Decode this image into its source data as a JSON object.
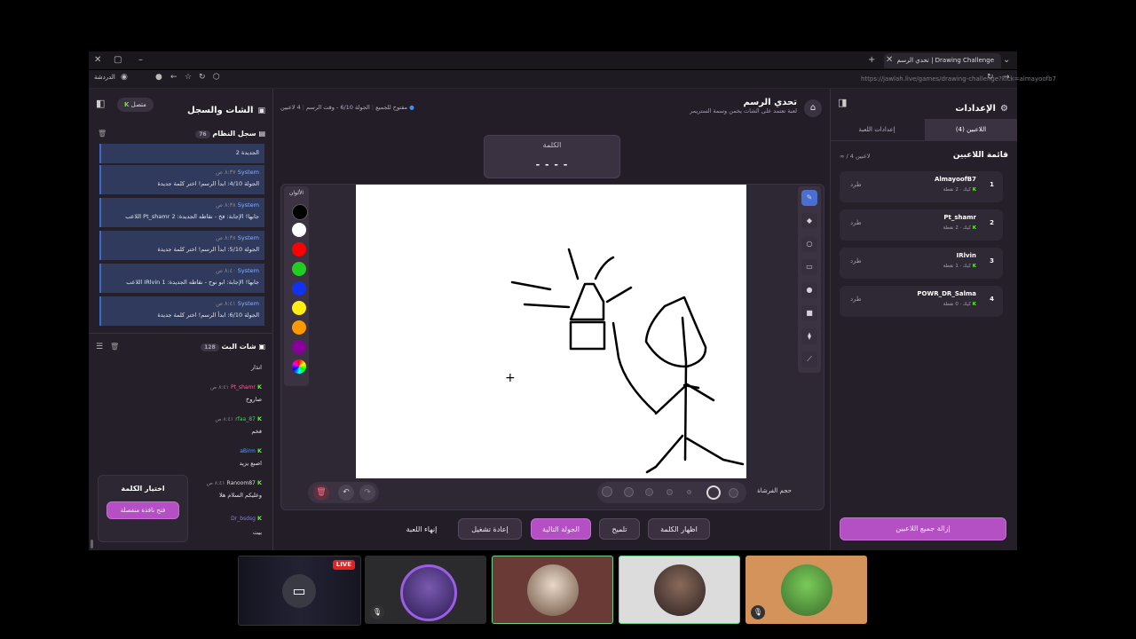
{
  "browser": {
    "tab_title": "تحدي الرسم | Drawing Challenge",
    "url": "https://jawlah.live/games/drawing-challenge?kick=almayoofb7",
    "sidebar_label": "الدردشة"
  },
  "header": {
    "title": "تحدي الرسم",
    "subtitle": "لعبة تعتمد على الشات يخمن وسمة الستريمر",
    "players_count": "4 لاعبين",
    "round_info": "الجولة 6/10 - وقت الرسم",
    "status": "مفتوح للجميع"
  },
  "word_card": {
    "label": "الكلمة",
    "value": "- - - -"
  },
  "colors_panel": {
    "title": "الألوان",
    "swatches": [
      "#000000",
      "#ffffff",
      "#ff0000",
      "#22cc22",
      "#1133ee",
      "#ffee11",
      "#ff9900",
      "#880099"
    ]
  },
  "brush": {
    "label": "حجم الفرشاة"
  },
  "settings": {
    "title": "الإعدادات",
    "tab_players": "اللاعبين (4)",
    "tab_game": "إعدادات اللعبة",
    "list_title": "قائمة اللاعبين",
    "list_count": "∞ / 4 لاعبين",
    "kick_label": "طرد",
    "players": [
      {
        "rank": "1",
        "name": "AlmayoofB7",
        "meta": "كيك · 2 نقطة"
      },
      {
        "rank": "2",
        "name": "Pt_shamr",
        "meta": "كيك · 2 نقطة"
      },
      {
        "rank": "3",
        "name": "IRlvin",
        "meta": "كيك · 1 نقطة"
      },
      {
        "rank": "4",
        "name": "POWR_DR_Salma",
        "meta": "كيك · 0 نقطة"
      }
    ],
    "remove_all": "إزالة جميع اللاعبين"
  },
  "actions": {
    "show_word": "اظهار الكلمة",
    "hint": "تلميح",
    "next_round": "الجولة التالية",
    "restart": "إعادة تشغيل",
    "end_game": "إنهاء اللعبة"
  },
  "chat_panel": {
    "title": "الشات والسجل",
    "status": "متصل",
    "log_title": "سجل النظام",
    "log_count": "76",
    "log_top": "الجديدة 2",
    "log": [
      {
        "sender": "System",
        "time": "٨:٣٧ ص",
        "text": "الجولة 4/10: ابدأ الرسم! اختر كلمة جديدة"
      },
      {
        "sender": "System",
        "time": "٨:٣٨ ص",
        "text": "اللاعب Pt_shamr جابها! الإجابة: فخ - نقاطه الجديدة: 2"
      },
      {
        "sender": "System",
        "time": "٨:٣٨ ص",
        "text": "الجولة 5/10: ابدأ الرسم! اختر كلمة جديدة"
      },
      {
        "sender": "System",
        "time": "٨:٤٠ ص",
        "text": "اللاعب IRlvin جابها! الإجابة: ابو نوح - نقاطه الجديدة: 1"
      },
      {
        "sender": "System",
        "time": "٨:٤١ ص",
        "text": "الجولة 6/10: ابدأ الرسم! اختر كلمة جديدة"
      }
    ],
    "live_chat_title": "شات البث",
    "live_chat_count": "128",
    "messages": [
      {
        "user": "",
        "time": "",
        "text": "انذار"
      },
      {
        "user": "Pt_shamr",
        "time": "٨:٤١ ص",
        "text": "صاروخ",
        "color": "#ff5a9a"
      },
      {
        "user": "rfaa_87",
        "time": "٨:٤١ ص",
        "text": "فخم",
        "color": "#55cc66"
      },
      {
        "user": "aBirm",
        "time": "",
        "text": "اصبع يزيد",
        "color": "#4aa3ff"
      },
      {
        "user": "Ranoom87",
        "time": "٨:٤١ ص",
        "text": "وعليكم السلام هلا",
        "color": "#dddddd"
      },
      {
        "user": "Dr_bsdsg",
        "time": "",
        "text": "بيت",
        "color": "#8a7ef0"
      }
    ],
    "pick_word_title": "اختيار الكلمة",
    "pick_word_button": "فتح نافذة منفصلة"
  },
  "video_strip": {
    "live_badge": "LIVE"
  }
}
